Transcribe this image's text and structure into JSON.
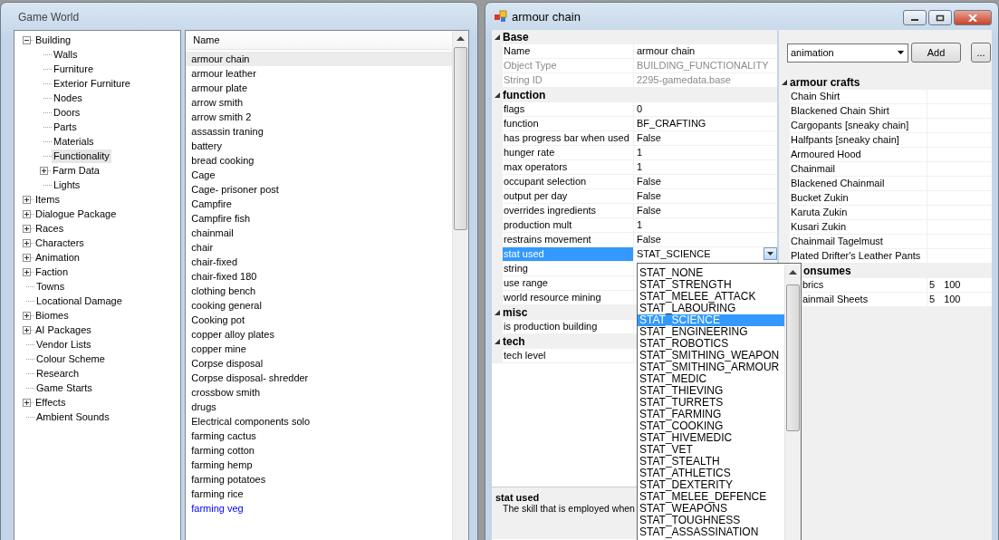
{
  "game_world": {
    "title": "Game World",
    "tree": [
      {
        "label": "Building",
        "kind": "group",
        "expanded": true,
        "selected": false,
        "children": [
          {
            "label": "Walls",
            "kind": "leaf",
            "selected": false
          },
          {
            "label": "Furniture",
            "kind": "leaf",
            "selected": false
          },
          {
            "label": "Exterior Furniture",
            "kind": "leaf",
            "selected": false
          },
          {
            "label": "Nodes",
            "kind": "leaf",
            "selected": false
          },
          {
            "label": "Doors",
            "kind": "leaf",
            "selected": false
          },
          {
            "label": "Parts",
            "kind": "leaf",
            "selected": false
          },
          {
            "label": "Materials",
            "kind": "leaf",
            "selected": false
          },
          {
            "label": "Functionality",
            "kind": "leaf",
            "selected": true
          },
          {
            "label": "Farm Data",
            "kind": "group",
            "expanded": false,
            "selected": false
          },
          {
            "label": "Lights",
            "kind": "leaf",
            "selected": false
          }
        ]
      },
      {
        "label": "Items",
        "kind": "group",
        "expanded": false,
        "selected": false
      },
      {
        "label": "Dialogue Package",
        "kind": "group",
        "expanded": false,
        "selected": false
      },
      {
        "label": "Races",
        "kind": "group",
        "expanded": false,
        "selected": false
      },
      {
        "label": "Characters",
        "kind": "group",
        "expanded": false,
        "selected": false
      },
      {
        "label": "Animation",
        "kind": "group",
        "expanded": false,
        "selected": false
      },
      {
        "label": "Faction",
        "kind": "group",
        "expanded": false,
        "selected": false
      },
      {
        "label": "Towns",
        "kind": "leaf",
        "selected": false
      },
      {
        "label": "Locational Damage",
        "kind": "leaf",
        "selected": false
      },
      {
        "label": "Biomes",
        "kind": "group",
        "expanded": false,
        "selected": false
      },
      {
        "label": "AI Packages",
        "kind": "group",
        "expanded": false,
        "selected": false
      },
      {
        "label": "Vendor Lists",
        "kind": "leaf",
        "selected": false
      },
      {
        "label": "Colour Scheme",
        "kind": "leaf",
        "selected": false
      },
      {
        "label": "Research",
        "kind": "leaf",
        "selected": false
      },
      {
        "label": "Game Starts",
        "kind": "leaf",
        "selected": false
      },
      {
        "label": "Effects",
        "kind": "group",
        "expanded": false,
        "selected": false
      },
      {
        "label": "Ambient Sounds",
        "kind": "leaf",
        "selected": false
      }
    ],
    "list": {
      "column": "Name",
      "items": [
        {
          "label": "armour chain",
          "selected": true,
          "modified": false
        },
        {
          "label": "armour leather",
          "selected": false,
          "modified": false
        },
        {
          "label": "armour plate",
          "selected": false,
          "modified": false
        },
        {
          "label": "arrow smith",
          "selected": false,
          "modified": false
        },
        {
          "label": "arrow smith 2",
          "selected": false,
          "modified": false
        },
        {
          "label": "assassin traning",
          "selected": false,
          "modified": false
        },
        {
          "label": "battery",
          "selected": false,
          "modified": false
        },
        {
          "label": "bread cooking",
          "selected": false,
          "modified": false
        },
        {
          "label": "Cage",
          "selected": false,
          "modified": false
        },
        {
          "label": "Cage- prisoner post",
          "selected": false,
          "modified": false
        },
        {
          "label": "Campfire",
          "selected": false,
          "modified": false
        },
        {
          "label": "Campfire fish",
          "selected": false,
          "modified": false
        },
        {
          "label": "chainmail",
          "selected": false,
          "modified": false
        },
        {
          "label": "chair",
          "selected": false,
          "modified": false
        },
        {
          "label": "chair-fixed",
          "selected": false,
          "modified": false
        },
        {
          "label": "chair-fixed 180",
          "selected": false,
          "modified": false
        },
        {
          "label": "clothing bench",
          "selected": false,
          "modified": false
        },
        {
          "label": "cooking general",
          "selected": false,
          "modified": false
        },
        {
          "label": "Cooking pot",
          "selected": false,
          "modified": false
        },
        {
          "label": "copper alloy plates",
          "selected": false,
          "modified": false
        },
        {
          "label": "copper mine",
          "selected": false,
          "modified": false
        },
        {
          "label": "Corpse disposal",
          "selected": false,
          "modified": false
        },
        {
          "label": "Corpse disposal- shredder",
          "selected": false,
          "modified": false
        },
        {
          "label": "crossbow smith",
          "selected": false,
          "modified": false
        },
        {
          "label": "drugs",
          "selected": false,
          "modified": false
        },
        {
          "label": "Electrical components solo",
          "selected": false,
          "modified": false
        },
        {
          "label": "farming cactus",
          "selected": false,
          "modified": false
        },
        {
          "label": "farming cotton",
          "selected": false,
          "modified": false
        },
        {
          "label": "farming hemp",
          "selected": false,
          "modified": false
        },
        {
          "label": "farming potatoes",
          "selected": false,
          "modified": false
        },
        {
          "label": "farming rice",
          "selected": false,
          "modified": false
        },
        {
          "label": "farming veg",
          "selected": false,
          "modified": true
        }
      ]
    }
  },
  "editor": {
    "title": "armour chain",
    "properties": [
      {
        "title": "Base",
        "expanded": true,
        "rows": [
          {
            "name": "Name",
            "value": "armour chain",
            "disabled": false,
            "selected": false
          },
          {
            "name": "Object Type",
            "value": "BUILDING_FUNCTIONALITY",
            "disabled": true,
            "selected": false
          },
          {
            "name": "String ID",
            "value": "2295-gamedata.base",
            "disabled": true,
            "selected": false
          }
        ]
      },
      {
        "title": "function",
        "expanded": true,
        "rows": [
          {
            "name": "flags",
            "value": "0",
            "disabled": false,
            "selected": false
          },
          {
            "name": "function",
            "value": "BF_CRAFTING",
            "disabled": false,
            "selected": false
          },
          {
            "name": "has progress bar when used",
            "value": "False",
            "disabled": false,
            "selected": false
          },
          {
            "name": "hunger rate",
            "value": "1",
            "disabled": false,
            "selected": false
          },
          {
            "name": "max operators",
            "value": "1",
            "disabled": false,
            "selected": false
          },
          {
            "name": "occupant selection",
            "value": "False",
            "disabled": false,
            "selected": false
          },
          {
            "name": "output per day",
            "value": "False",
            "disabled": false,
            "selected": false
          },
          {
            "name": "overrides ingredients",
            "value": "False",
            "disabled": false,
            "selected": false
          },
          {
            "name": "production mult",
            "value": "1",
            "disabled": false,
            "selected": false
          },
          {
            "name": "restrains movement",
            "value": "False",
            "disabled": false,
            "selected": false
          },
          {
            "name": "stat used",
            "value": "STAT_SCIENCE",
            "disabled": false,
            "selected": true
          },
          {
            "name": "string",
            "disabled": false,
            "selected": false
          },
          {
            "name": "use range",
            "disabled": false,
            "selected": false
          },
          {
            "name": "world resource mining",
            "disabled": false,
            "selected": false
          }
        ]
      },
      {
        "title": "misc",
        "expanded": true,
        "rows": [
          {
            "name": "is production building",
            "disabled": false,
            "selected": false
          }
        ]
      },
      {
        "title": "tech",
        "expanded": true,
        "rows": [
          {
            "name": "tech level",
            "disabled": false,
            "selected": false
          }
        ]
      }
    ],
    "description": {
      "title": "stat used",
      "text": "The skill that is employed when"
    },
    "dropdown": {
      "options": [
        {
          "label": "STAT_NONE",
          "selected": false
        },
        {
          "label": "STAT_STRENGTH",
          "selected": false
        },
        {
          "label": "STAT_MELEE_ATTACK",
          "selected": false
        },
        {
          "label": "STAT_LABOURING",
          "selected": false
        },
        {
          "label": "STAT_SCIENCE",
          "selected": true
        },
        {
          "label": "STAT_ENGINEERING",
          "selected": false
        },
        {
          "label": "STAT_ROBOTICS",
          "selected": false
        },
        {
          "label": "STAT_SMITHING_WEAPON",
          "selected": false
        },
        {
          "label": "STAT_SMITHING_ARMOUR",
          "selected": false
        },
        {
          "label": "STAT_MEDIC",
          "selected": false
        },
        {
          "label": "STAT_THIEVING",
          "selected": false
        },
        {
          "label": "STAT_TURRETS",
          "selected": false
        },
        {
          "label": "STAT_FARMING",
          "selected": false
        },
        {
          "label": "STAT_COOKING",
          "selected": false
        },
        {
          "label": "STAT_HIVEMEDIC",
          "selected": false
        },
        {
          "label": "STAT_VET",
          "selected": false
        },
        {
          "label": "STAT_STEALTH",
          "selected": false
        },
        {
          "label": "STAT_ATHLETICS",
          "selected": false
        },
        {
          "label": "STAT_DEXTERITY",
          "selected": false
        },
        {
          "label": "STAT_MELEE_DEFENCE",
          "selected": false
        },
        {
          "label": "STAT_WEAPONS",
          "selected": false
        },
        {
          "label": "STAT_TOUGHNESS",
          "selected": false
        },
        {
          "label": "STAT_ASSASSINATION",
          "selected": false
        }
      ]
    },
    "reference_type": {
      "value": "animation"
    },
    "buttons": [
      "Add",
      "..."
    ],
    "references": [
      {
        "title": "armour crafts",
        "expanded": true,
        "rows": [
          {
            "name": "Chain Shirt"
          },
          {
            "name": "Blackened Chain Shirt"
          },
          {
            "name": "Cargopants [sneaky chain]"
          },
          {
            "name": "Halfpants [sneaky chain]"
          },
          {
            "name": "Armoured Hood"
          },
          {
            "name": "Chainmail"
          },
          {
            "name": "Blackened Chainmail"
          },
          {
            "name": "Bucket Zukin"
          },
          {
            "name": "Karuta Zukin"
          },
          {
            "name": "Kusari Zukin"
          },
          {
            "name": "Chainmail Tagelmust"
          },
          {
            "name": "Plated Drifter's Leather Pants"
          }
        ]
      },
      {
        "title": "onsumes",
        "rows": [
          {
            "name": "brics",
            "values": [
              "5",
              "100"
            ]
          },
          {
            "name": "ainmail Sheets",
            "values": [
              "5",
              "100"
            ]
          }
        ]
      }
    ]
  }
}
